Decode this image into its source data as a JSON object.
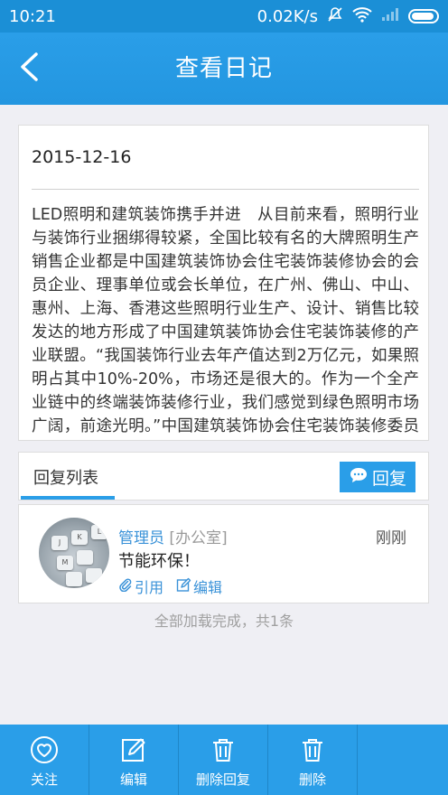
{
  "status_bar": {
    "time": "10:21",
    "network_speed": "0.02K/s",
    "icons": [
      "mute-icon",
      "wifi-icon",
      "signal-icon",
      "battery-icon"
    ]
  },
  "header": {
    "title": "查看日记",
    "back_icon": "chevron-left-icon"
  },
  "diary": {
    "date": "2015-12-16",
    "content": "LED照明和建筑装饰携手并进　从目前来看，照明行业与装饰行业捆绑得较紧，全国比较有名的大牌照明生产销售企业都是中国建筑装饰协会住宅装饰装修协会的会员企业、理事单位或会长单位，在广州、佛山、中山、惠州、上海、香港这些照明行业生产、设计、销售比较发达的地方形成了中国建筑装饰协会住宅装饰装修的产业联盟。“我国装饰行业去年产值达到2万亿元，如果照明占其中10%-20%，市场还是很大的。作为一个全产业链中的终端装饰装修行业，我们感觉到绿色照明市场广阔，前途光明。”中国建筑装饰协会住宅装饰装修委员会秘书长张仁就绿色照明提出了自己的看"
  },
  "replies": {
    "section_title": "回复列表",
    "reply_button": "回复",
    "items": [
      {
        "author": "管理员",
        "department": "[办公室]",
        "time": "刚刚",
        "content": "节能环保！",
        "quote_label": "引用",
        "edit_label": "编辑"
      }
    ],
    "footer": "全部加载完成，共1条"
  },
  "bottom_bar": {
    "tabs": [
      {
        "label": "关注",
        "icon": "heart-icon"
      },
      {
        "label": "编辑",
        "icon": "edit-icon"
      },
      {
        "label": "删除回复",
        "icon": "trash-icon"
      },
      {
        "label": "删除",
        "icon": "trash-icon"
      }
    ]
  },
  "colors": {
    "accent": "#2a9ee8",
    "status_bar": "#1b8fd6",
    "link": "#3a92d8",
    "background": "#efeff4"
  }
}
